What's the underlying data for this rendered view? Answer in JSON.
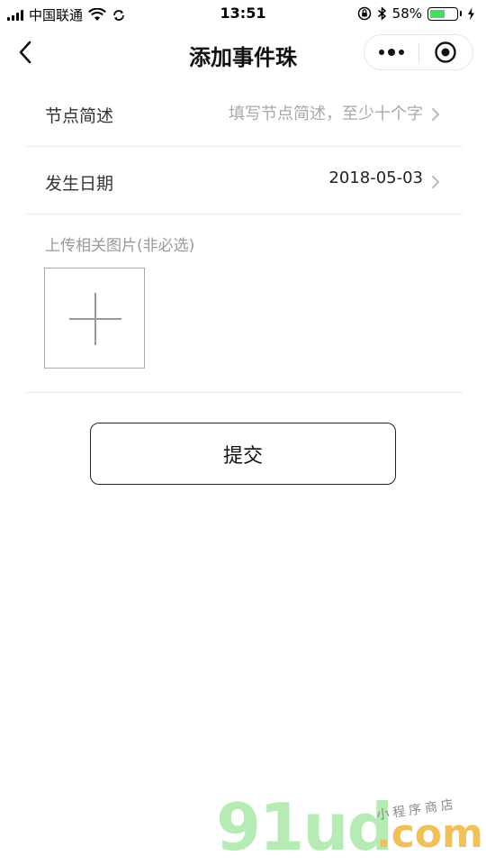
{
  "status_bar": {
    "carrier": "中国联通",
    "time": "13:51",
    "battery_percent": "58%",
    "battery_level": 0.58,
    "battery_color": "#4cd964"
  },
  "nav": {
    "title": "添加事件珠",
    "back_icon": "chevron-left-icon",
    "more_icon": "more-dots-icon",
    "close_icon": "target-circle-icon"
  },
  "form": {
    "summary": {
      "label": "节点简述",
      "placeholder": "填写节点简述，至少十个字"
    },
    "date": {
      "label": "发生日期",
      "value": "2018-05-03"
    },
    "upload": {
      "label": "上传相关图片(非必选)",
      "icon": "plus-icon"
    }
  },
  "actions": {
    "submit_label": "提交"
  },
  "watermark": {
    "brand": "91ud",
    "suffix": ".com",
    "tagline": "小程序商店"
  }
}
